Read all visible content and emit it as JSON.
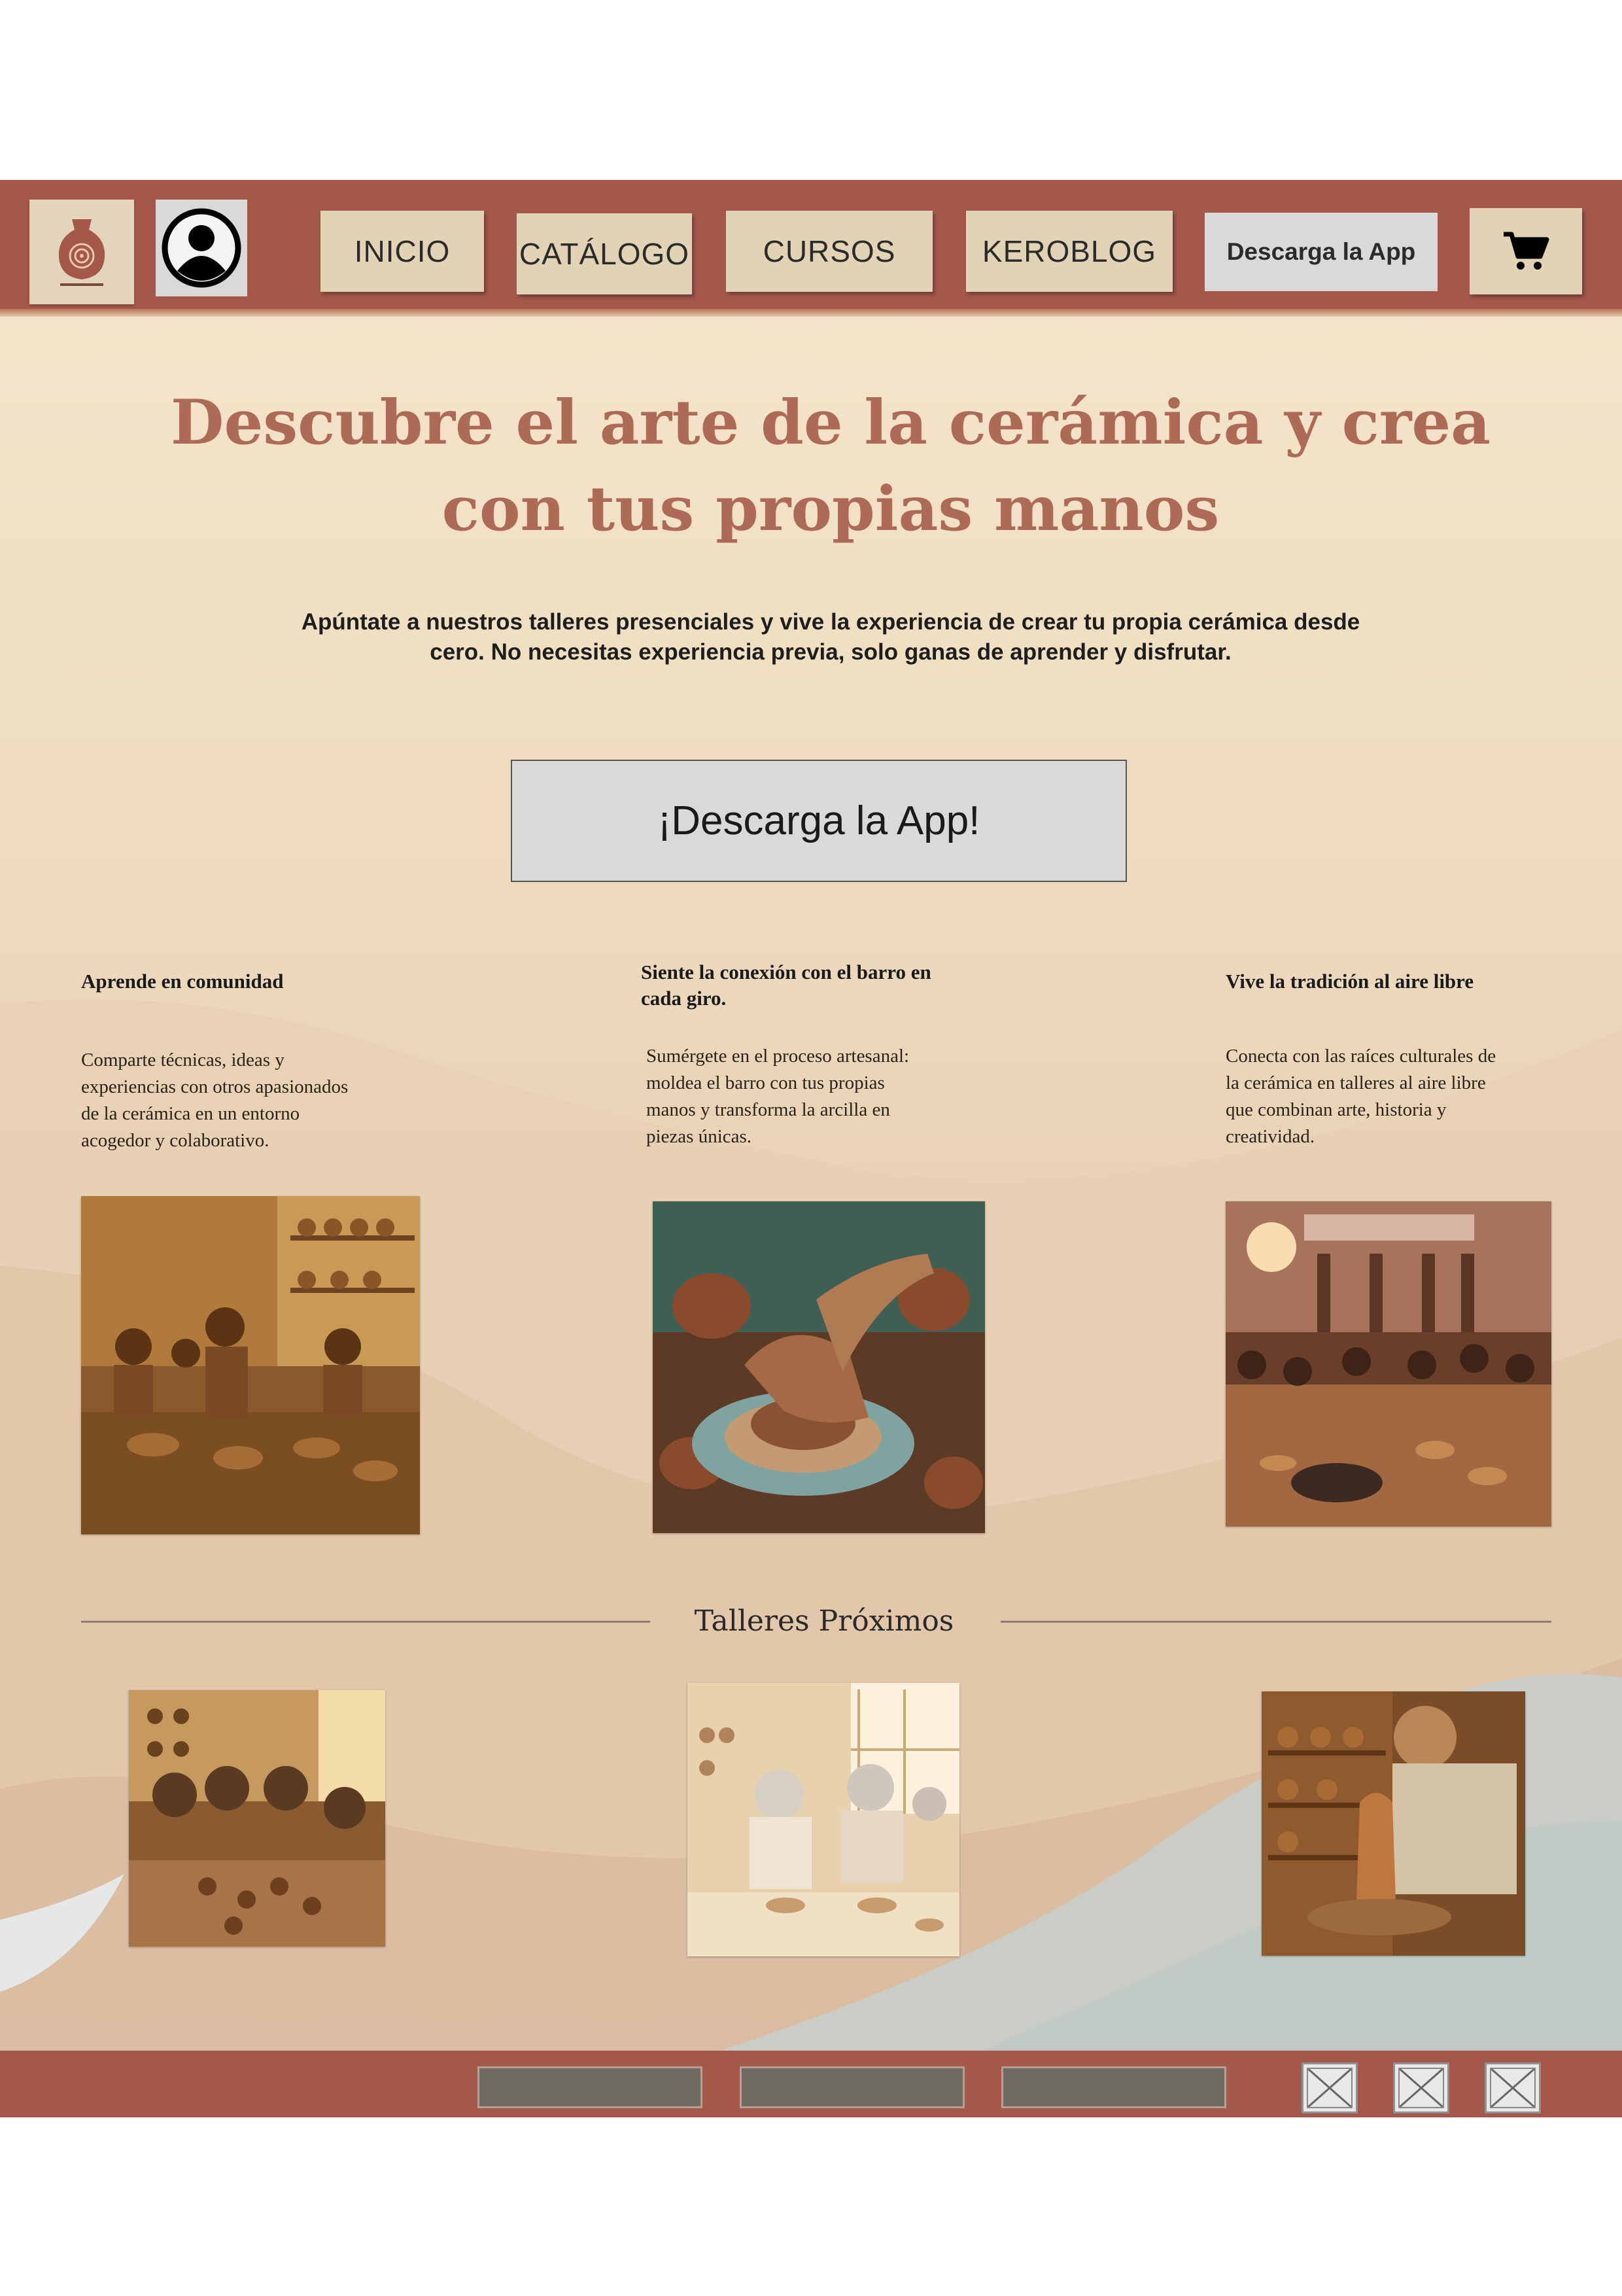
{
  "header": {
    "logo_icon": "ceramics-logo",
    "profile_icon": "user-profile-icon",
    "nav": [
      "INICIO",
      "CATÁLOGO",
      "CURSOS",
      "KEROBLOG"
    ],
    "download_label": "Descarga la App",
    "cart_icon": "shopping-cart-icon"
  },
  "hero": {
    "title_line1": "Descubre el arte de la cerámica y crea",
    "title_line2": "con tus propias manos",
    "subtitle_line1": "Apúntate a nuestros talleres presenciales y vive la experiencia de crear tu propia cerámica desde",
    "subtitle_line2": "cero. No necesitas experiencia previa, solo ganas de aprender y disfrutar.",
    "cta": "¡Descarga la App!"
  },
  "features": [
    {
      "title": "Aprende en comunidad",
      "text": [
        "Comparte técnicas, ideas y",
        "experiencias con otros apasionados",
        "de la cerámica en un entorno",
        "acogedor y colaborativo."
      ]
    },
    {
      "title": [
        "Siente la conexión con el barro en",
        "cada giro."
      ],
      "text": [
        "Sumérgete en el proceso artesanal:",
        "moldea el barro con tus propias",
        "manos y transforma la arcilla en",
        "piezas únicas."
      ]
    },
    {
      "title": "Vive la tradición al aire libre",
      "text": [
        "Conecta con las raíces culturales de",
        "la cerámica en talleres al aire libre",
        "que combinan arte, historia y",
        "creatividad."
      ]
    }
  ],
  "upcoming": {
    "title": "Talleres Próximos"
  },
  "footer": {
    "image_placeholder_icon": "broken-image-icon"
  },
  "colors": {
    "brand": "#a4584a",
    "button_beige": "#e3d3b6",
    "title": "#ad6a56",
    "cta_gray": "#d9d9d9"
  }
}
